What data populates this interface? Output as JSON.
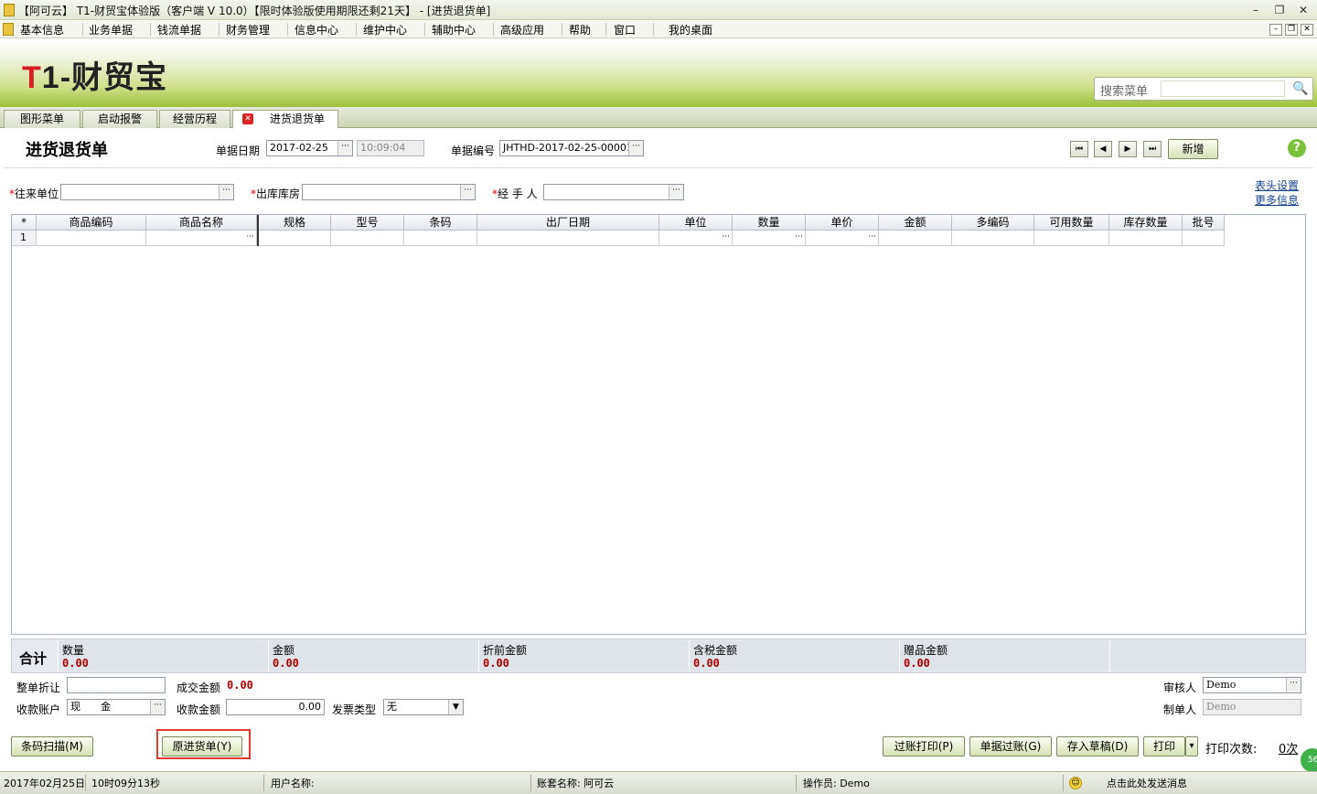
{
  "window": {
    "title": "【阿可云】 T1-财贸宝体验版（客户端 V 10.0）【限时体验版使用期限还剩21天】 - [进货退货单]",
    "minimize": "–",
    "restore": "❐",
    "close": "✕"
  },
  "menu": [
    "基本信息",
    "业务单据",
    "钱流单据",
    "财务管理",
    "信息中心",
    "维护中心",
    "辅助中心",
    "高级应用",
    "帮助",
    "窗口",
    "我的桌面"
  ],
  "banner": {
    "logo_t": "T",
    "logo_rest": "1-财贸宝",
    "search_placeholder": "搜索菜单"
  },
  "tabs": [
    "图形菜单",
    "启动报警",
    "经营历程",
    "进货退货单"
  ],
  "doc": {
    "title": "进货退货单",
    "date_label": "单据日期",
    "date_value": "2017-02-25",
    "time_value": "10:09:04",
    "number_label": "单据编号",
    "number_value": "JHTHD-2017-02-25-00001",
    "new_button": "新增",
    "help": "?",
    "partner_label": "往来单位",
    "warehouse_label": "出库库房",
    "handler_label": "经 手 人",
    "header_settings": "表头设置",
    "more_info": "更多信息",
    "ellipsis": "···",
    "nav": [
      "⏮",
      "◀",
      "▶",
      "⏭"
    ]
  },
  "grid": {
    "corner": "*",
    "columns": [
      "商品编码",
      "商品名称",
      "规格",
      "型号",
      "条码",
      "出厂日期",
      "单位",
      "数量",
      "单价",
      "金额",
      "多编码",
      "可用数量",
      "库存数量",
      "批号"
    ],
    "row_number": "1"
  },
  "totals": {
    "label": "合计",
    "items": [
      {
        "name": "数量",
        "value": "0.00"
      },
      {
        "name": "金额",
        "value": "0.00"
      },
      {
        "name": "折前金额",
        "value": "0.00"
      },
      {
        "name": "含税金额",
        "value": "0.00"
      },
      {
        "name": "赠品金额",
        "value": "0.00"
      }
    ]
  },
  "footer": {
    "discount_label": "整单折让",
    "deal_amount_label": "成交金额",
    "deal_amount_value": "0.00",
    "account_label": "收款账户",
    "account_value": "现　　金",
    "receive_label": "收款金额",
    "receive_value": "0.00",
    "invoice_label": "发票类型",
    "invoice_value": "无",
    "auditor_label": "审核人",
    "auditor_value": "Demo",
    "maker_label": "制单人",
    "maker_value": "Demo",
    "dropdown_arrow": "▼"
  },
  "buttons": {
    "barcode_scan": "条码扫描(M)",
    "original_purchase": "原进货单(Y)",
    "post_print": "过账打印(P)",
    "post": "单据过账(G)",
    "save_draft": "存入草稿(D)",
    "print": "打印",
    "print_arrow": "▾",
    "print_count_label": "打印次数:",
    "print_count_value": "0次"
  },
  "status": {
    "date": "2017年02月25日",
    "time": "10时09分13秒",
    "user_label": "用户名称:",
    "account_set": "账套名称: 阿可云",
    "operator": "操作员: Demo",
    "message": "点击此处发送消息",
    "badge": "56"
  }
}
